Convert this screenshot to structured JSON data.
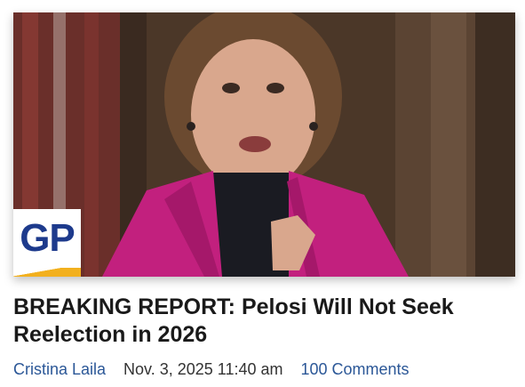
{
  "article": {
    "title": "BREAKING REPORT: Pelosi Will Not Seek Reelection in 2026",
    "author": "Cristina Laila",
    "datetime": "Nov. 3, 2025 11:40 am",
    "comments": "100 Comments"
  },
  "logo": {
    "text": "GP",
    "colors": {
      "text": "#1d3a8c",
      "accent": "#f2b01e"
    }
  },
  "theme": {
    "link_color": "#2b5797",
    "title_color": "#1a1a1a"
  }
}
